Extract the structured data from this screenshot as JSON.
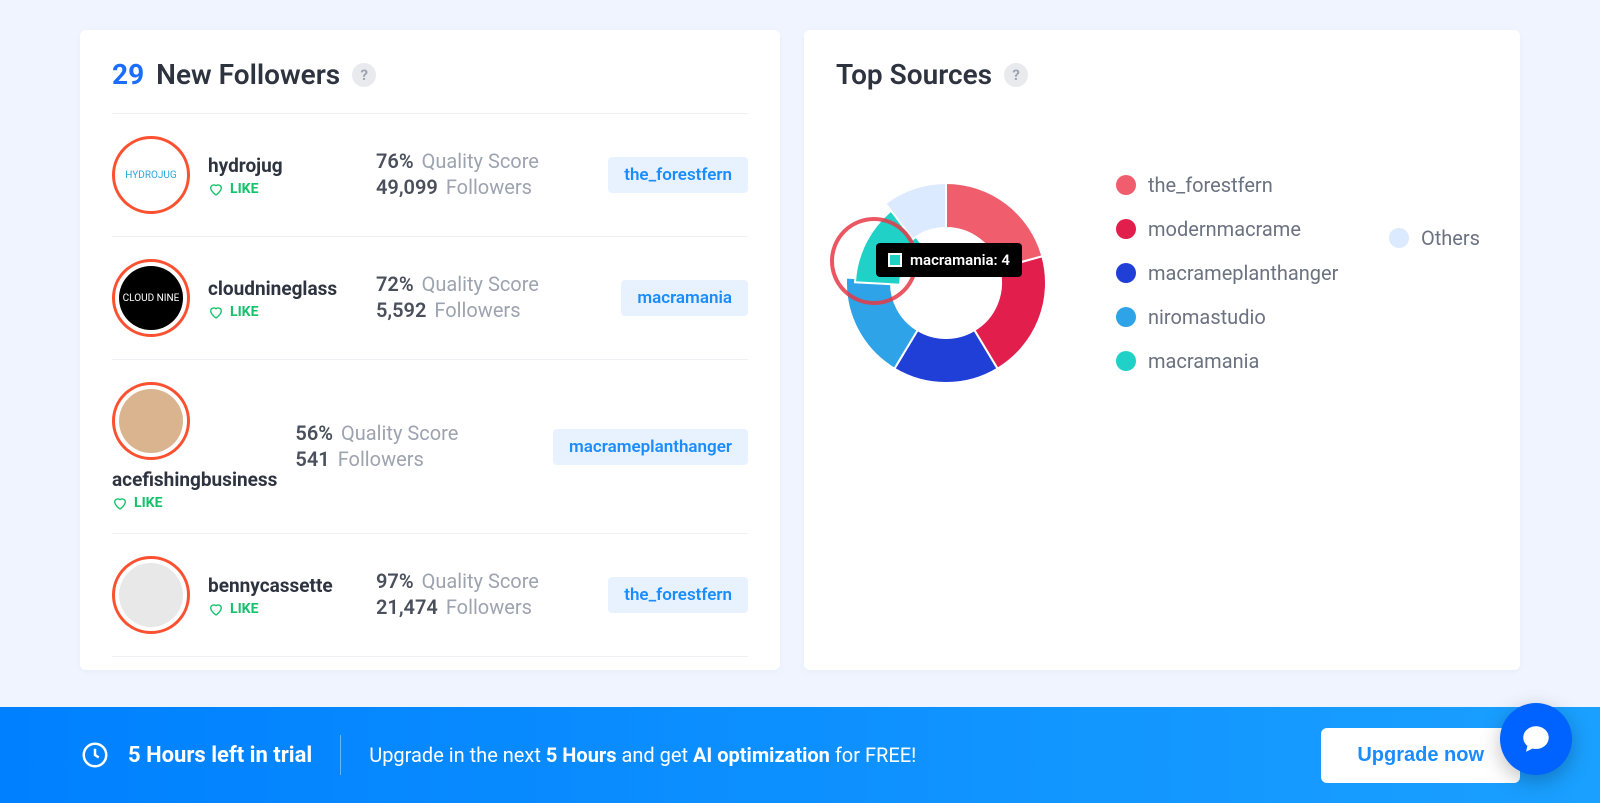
{
  "left_panel": {
    "count": "29",
    "title": "New Followers",
    "followers": [
      {
        "username": "hydrojug",
        "like": "LIKE",
        "quality": "76%",
        "followers": "49,099",
        "source": "the_forestfern",
        "avatar_bg": "#ffffff",
        "avatar_label": "HYDROJUG"
      },
      {
        "username": "cloudnineglass",
        "like": "LIKE",
        "quality": "72%",
        "followers": "5,592",
        "source": "macramania",
        "avatar_bg": "#000000",
        "avatar_label": "CLOUD NINE"
      },
      {
        "username": "acefishingbusiness",
        "like": "LIKE",
        "quality": "56%",
        "followers": "541",
        "source": "macrameplanthanger",
        "avatar_bg": "#d9b48f",
        "avatar_label": ""
      },
      {
        "username": "bennycassette",
        "like": "LIKE",
        "quality": "97%",
        "followers": "21,474",
        "source": "the_forestfern",
        "avatar_bg": "#e8e8e8",
        "avatar_label": ""
      }
    ],
    "quality_label": "Quality Score",
    "followers_label": "Followers"
  },
  "right_panel": {
    "title": "Top Sources",
    "legend": [
      {
        "label": "the_forestfern",
        "color": "#f05d6c"
      },
      {
        "label": "modernmacrame",
        "color": "#e21e4d"
      },
      {
        "label": "macrameplanthanger",
        "color": "#1f3fd6"
      },
      {
        "label": "niromastudio",
        "color": "#2ea3e8"
      },
      {
        "label": "macramania",
        "color": "#1fd1c7"
      }
    ],
    "others_label": "Others",
    "others_color": "#dbeafe",
    "tooltip": {
      "label": "macramania: 4",
      "swatch": "#1fd1c7"
    }
  },
  "trial_bar": {
    "time_left": "5 Hours left in trial",
    "msg_prefix": "Upgrade in the next ",
    "msg_hours": "5 Hours",
    "msg_mid": " and get ",
    "msg_ai": "AI optimization",
    "msg_suffix": " for FREE!",
    "button": "Upgrade now"
  },
  "chart_data": {
    "type": "pie",
    "title": "Top Sources",
    "series": [
      {
        "name": "the_forestfern",
        "value": 6,
        "color": "#f05d6c"
      },
      {
        "name": "modernmacrame",
        "value": 6,
        "color": "#e21e4d"
      },
      {
        "name": "macrameplanthanger",
        "value": 5,
        "color": "#1f3fd6"
      },
      {
        "name": "niromastudio",
        "value": 5,
        "color": "#2ea3e8"
      },
      {
        "name": "macramania",
        "value": 4,
        "color": "#1fd1c7"
      },
      {
        "name": "Others",
        "value": 3,
        "color": "#dbeafe"
      }
    ]
  }
}
